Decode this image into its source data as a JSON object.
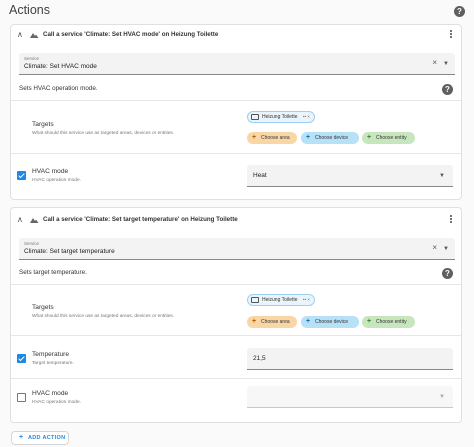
{
  "section": {
    "title": "Actions",
    "help_glyph": "?"
  },
  "actions": [
    {
      "title": "Call a service 'Climate: Set HVAC mode' on Heizung Toilette",
      "service_label": "Service",
      "service_value": "Climate: Set HVAC mode",
      "description": "Sets HVAC operation mode.",
      "targets_label": "Targets",
      "targets_sub": "What should this service use as targeted areas, devices or entities.",
      "target_chip": "Heizung Toilette",
      "target_chip_actions": "•• ×",
      "choose_area": "Choose area",
      "choose_device": "Choose device",
      "choose_entity": "Choose entity",
      "fields": [
        {
          "label": "HVAC mode",
          "sub": "HVAC operation mode.",
          "value": "Heat",
          "checked": true
        }
      ]
    },
    {
      "title": "Call a service 'Climate: Set target temperature' on Heizung Toilette",
      "service_label": "Service",
      "service_value": "Climate: Set target temperature",
      "description": "Sets target temperature.",
      "targets_label": "Targets",
      "targets_sub": "What should this service use as targeted areas, devices or entities.",
      "target_chip": "Heizung Toilette",
      "target_chip_actions": "•• ×",
      "choose_area": "Choose area",
      "choose_device": "Choose device",
      "choose_entity": "Choose entity",
      "fields": [
        {
          "label": "Temperature",
          "sub": "Target temperature.",
          "value": "21,5",
          "checked": true
        },
        {
          "label": "HVAC mode",
          "sub": "HVAC operation mode.",
          "value": "",
          "checked": false
        }
      ]
    }
  ],
  "add_action": {
    "label": "ADD ACTION"
  },
  "glyphs": {
    "chevron": "∧",
    "clear": "×",
    "dropdown": "▼",
    "plus": "+"
  },
  "icons": {
    "cloud": "cloud-icon",
    "kebab": "more-vert-icon",
    "help": "help-circle-icon",
    "device": "device-icon",
    "checkbox": "checkbox-icon"
  },
  "colors": {
    "accent": "#1e88e5",
    "area_chip": "#f9d6a6",
    "device_chip": "#b6e1f7",
    "entity_chip": "#c8e6bd"
  }
}
